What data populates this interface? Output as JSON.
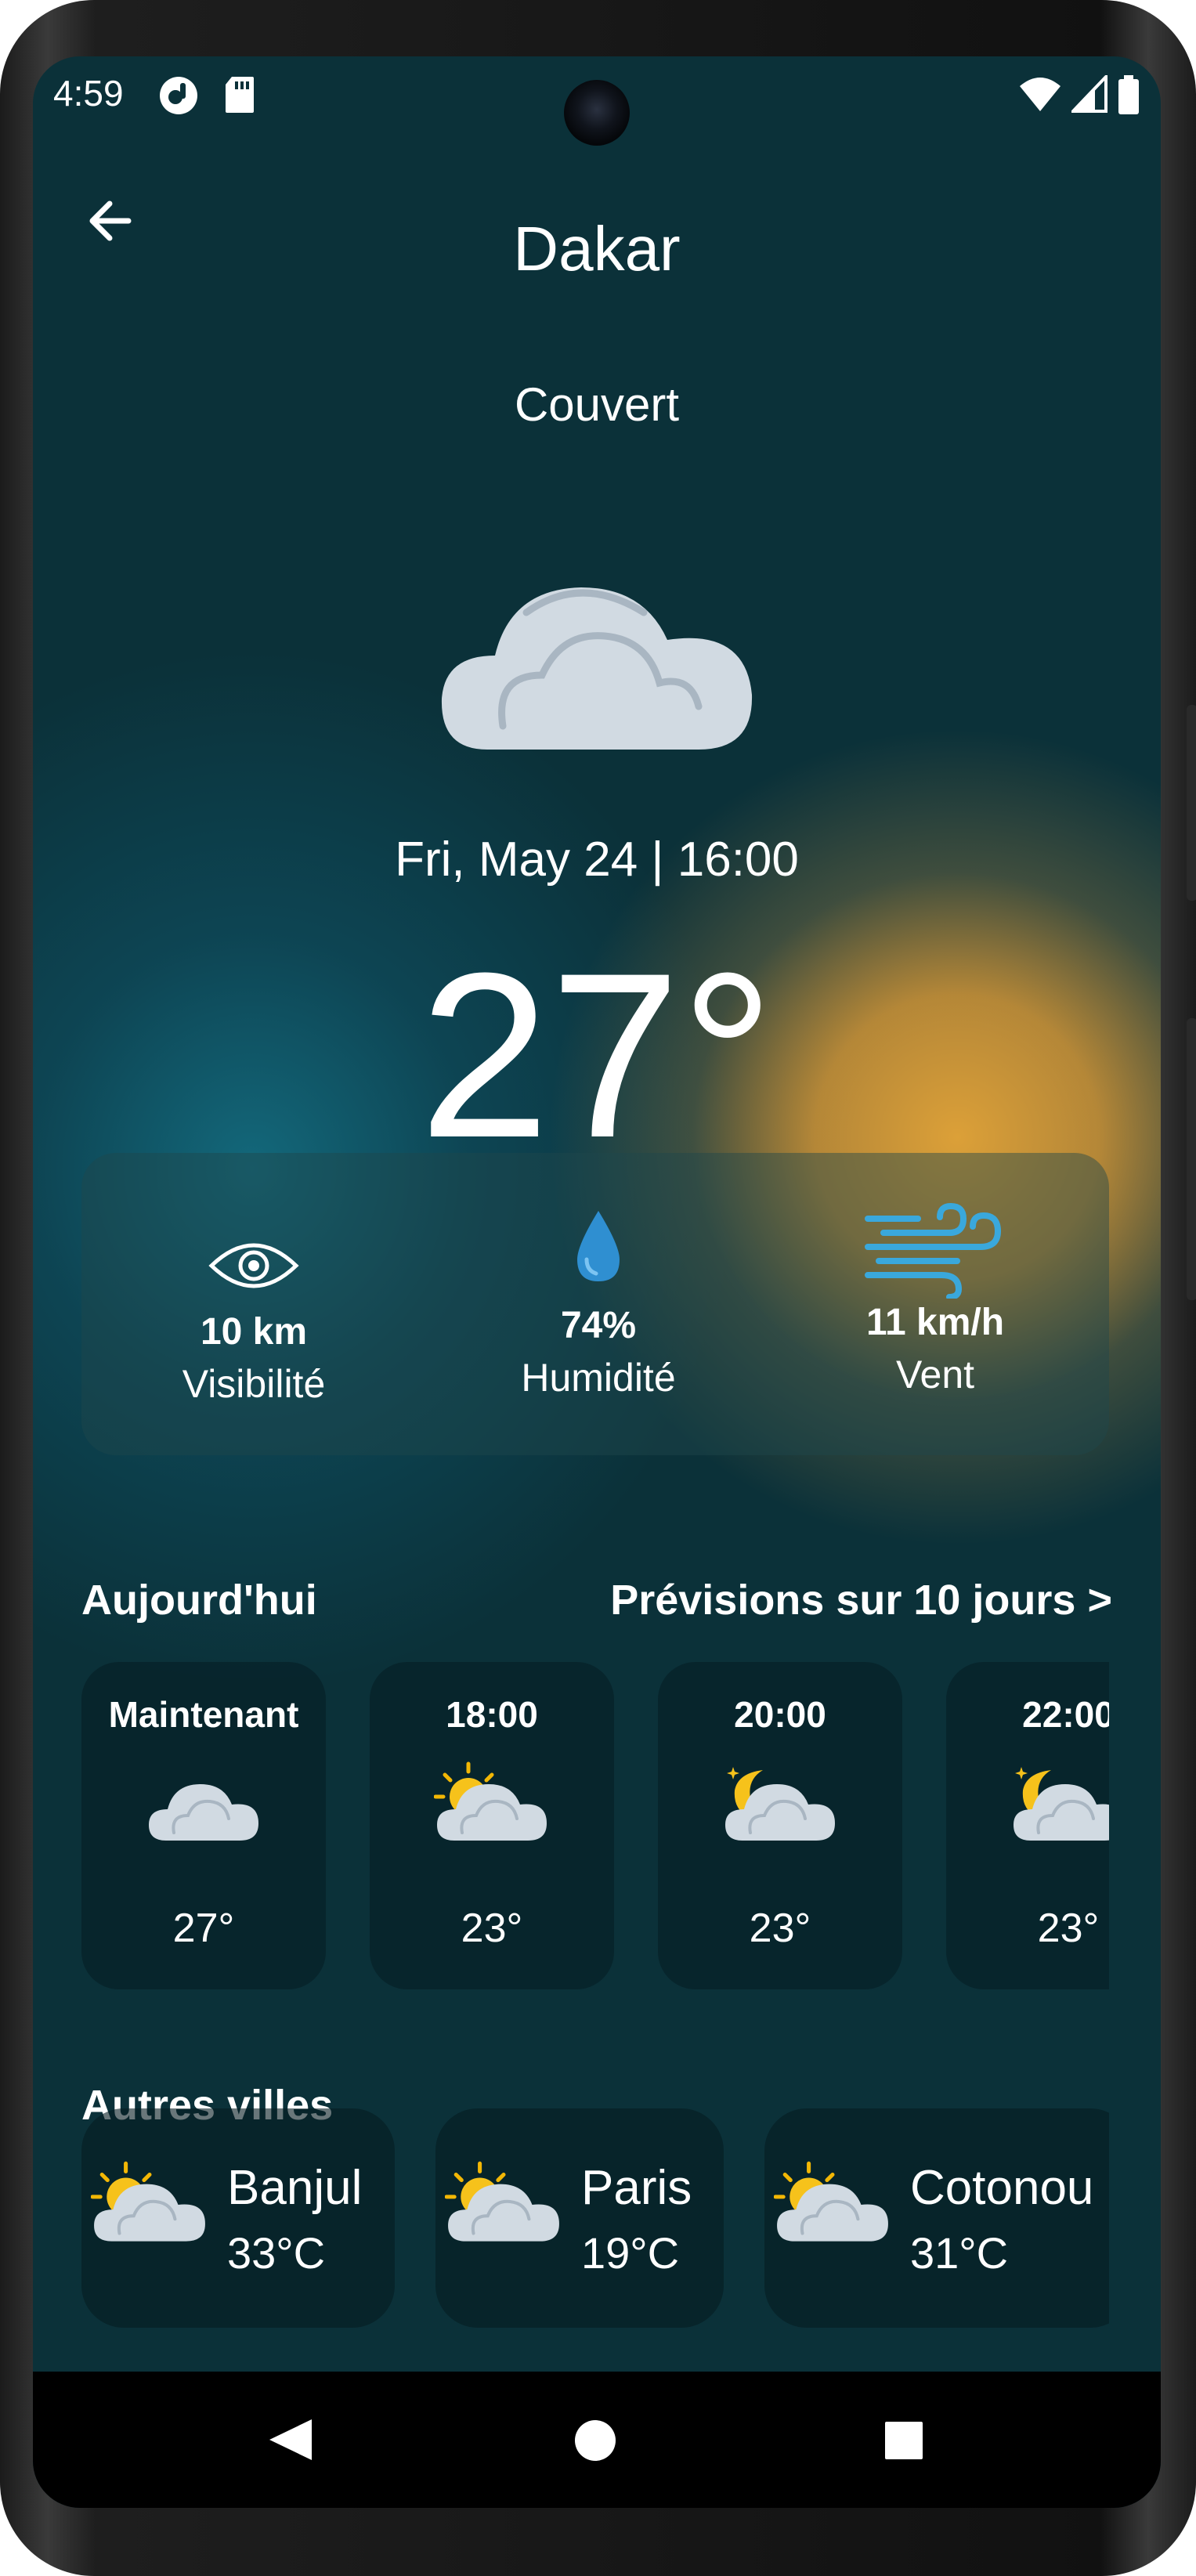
{
  "status_bar": {
    "time": "4:59",
    "icons": [
      "notification-icon",
      "sd-card-icon",
      "wifi-icon",
      "signal-icon",
      "battery-icon"
    ]
  },
  "header": {
    "back_icon": "arrow-left-icon",
    "city": "Dakar"
  },
  "current": {
    "condition": "Couvert",
    "icon": "cloud-icon",
    "datetime": "Fri, May 24 | 16:00",
    "temperature": "27°"
  },
  "stats": [
    {
      "icon": "eye-icon",
      "value": "10 km",
      "label": "Visibilité"
    },
    {
      "icon": "water-drop-icon",
      "value": "74%",
      "label": "Humidité"
    },
    {
      "icon": "wind-icon",
      "value": "11 km/h",
      "label": "Vent"
    }
  ],
  "today": {
    "heading": "Aujourd'hui",
    "forecast_link": "Prévisions sur 10 jours >",
    "hours": [
      {
        "time": "Maintenant",
        "icon": "cloud-icon",
        "temp": "27°"
      },
      {
        "time": "18:00",
        "icon": "sun-cloud-icon",
        "temp": "23°"
      },
      {
        "time": "20:00",
        "icon": "moon-cloud-icon",
        "temp": "23°"
      },
      {
        "time": "22:00",
        "icon": "moon-cloud-icon",
        "temp": "23°"
      }
    ]
  },
  "other_cities": {
    "heading": "Autres villes",
    "cities": [
      {
        "name": "Banjul",
        "temp": "33°C",
        "icon": "sun-cloud-icon"
      },
      {
        "name": "Paris",
        "temp": "19°C",
        "icon": "sun-cloud-icon"
      },
      {
        "name": "Cotonou",
        "temp": "31°C",
        "icon": "sun-cloud-icon"
      }
    ]
  },
  "nav_bar": {
    "back": "back-triangle-icon",
    "home": "home-circle-icon",
    "recents": "recents-square-icon"
  },
  "colors": {
    "background": "#0b3139",
    "sun_glow": "#e7a638",
    "card": "#0a2a31",
    "wind_blue": "#3aa8dc",
    "drop_blue": "#2f8fd1"
  }
}
